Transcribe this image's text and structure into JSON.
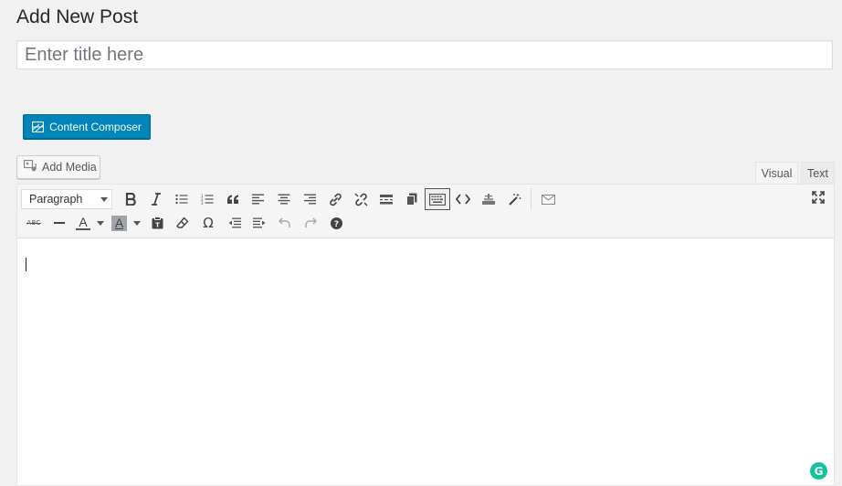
{
  "page": {
    "title": "Add New Post"
  },
  "title_field": {
    "placeholder": "Enter title here",
    "value": ""
  },
  "composer": {
    "label": "Content Composer"
  },
  "media": {
    "label": "Add Media"
  },
  "tabs": {
    "visual": "Visual",
    "text": "Text"
  },
  "toolbar": {
    "format_value": "Paragraph",
    "strike_label": "ABC",
    "text_color_letter": "A",
    "bg_color_letter": "A",
    "text_color": "#555555",
    "bg_color": "#a0a5aa"
  },
  "grammarly": {
    "letter": "G",
    "color": "#15c39a"
  },
  "colors": {
    "primary_button": "#0085ba",
    "background": "#f1f1f1"
  }
}
